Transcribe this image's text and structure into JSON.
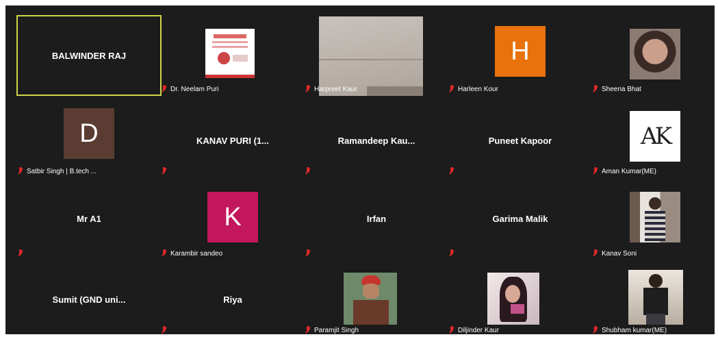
{
  "participants": [
    {
      "name": "BALWINDER RAJ",
      "label": "",
      "muted": false,
      "active": true
    },
    {
      "name": "",
      "label": "Dr. Neelam Puri",
      "muted": true,
      "kind": "image-flyer"
    },
    {
      "name": "",
      "label": "Harpreet Kaur",
      "muted": true,
      "kind": "video-wall"
    },
    {
      "name": "",
      "label": "Harleen Kour",
      "muted": true,
      "kind": "avatar",
      "initial": "H",
      "color": "#e8720c"
    },
    {
      "name": "",
      "label": "Sheena Bhat",
      "muted": true,
      "kind": "photo"
    },
    {
      "name": "",
      "label": "Satbir Singh | B.tech ...",
      "muted": true,
      "kind": "avatar",
      "initial": "D",
      "color": "#5a3c32"
    },
    {
      "name": "KANAV PURI (1...",
      "label": "",
      "muted": true
    },
    {
      "name": "Ramandeep  Kau...",
      "label": "",
      "muted": true
    },
    {
      "name": "Puneet Kapoor",
      "label": "",
      "muted": true
    },
    {
      "name": "",
      "label": "Aman Kumar(ME)",
      "muted": true,
      "kind": "logo",
      "logo_text": "AK"
    },
    {
      "name": "Mr A1",
      "label": "",
      "muted": true
    },
    {
      "name": "",
      "label": "Karambir sandeo",
      "muted": true,
      "kind": "avatar",
      "initial": "K",
      "color": "#c2185b"
    },
    {
      "name": "Irfan",
      "label": "",
      "muted": true
    },
    {
      "name": "Garima Malik",
      "label": "",
      "muted": true
    },
    {
      "name": "",
      "label": "Kanav Soni",
      "muted": true,
      "kind": "photo"
    },
    {
      "name": "Sumit  (GND uni...",
      "label": "",
      "muted": false
    },
    {
      "name": "Riya",
      "label": "",
      "muted": true
    },
    {
      "name": "",
      "label": "Paramjit Singh",
      "muted": true,
      "kind": "photo"
    },
    {
      "name": "",
      "label": "Diljinder Kaur",
      "muted": true,
      "kind": "photo"
    },
    {
      "name": "",
      "label": "Shubham kumar(ME)",
      "muted": true,
      "kind": "photo"
    }
  ],
  "colors": {
    "background": "#1c1c1c",
    "active_border": "#cfd74a",
    "mute_icon": "#e02828"
  }
}
